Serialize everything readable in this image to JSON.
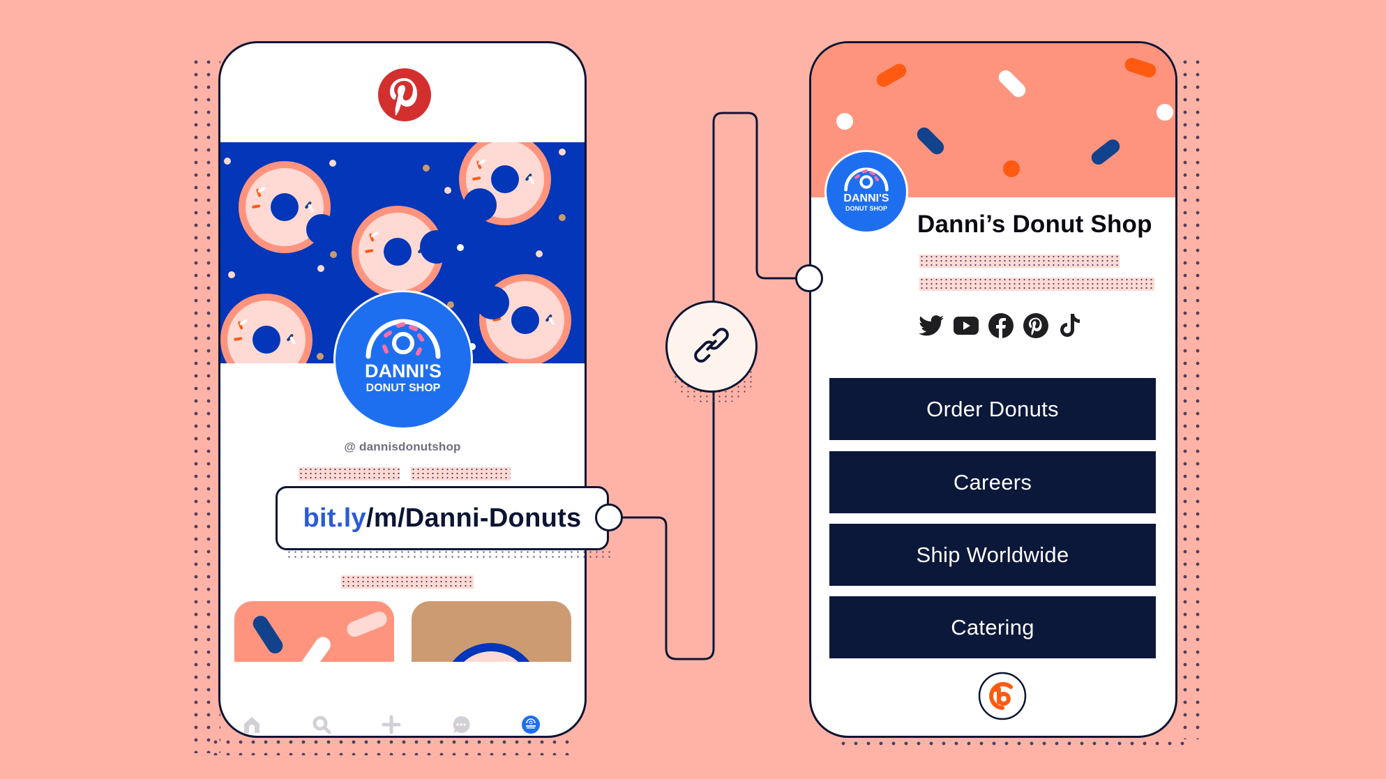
{
  "theme": {
    "background": "#ffb3a7",
    "outline": "#0c1433",
    "pinterest_red": "#d32f2f",
    "banner_blue": "#0336b8",
    "brand_blue": "#1e6ff0",
    "coral": "#ff947e",
    "button_navy": "#0c1839",
    "bitly_orange": "#ff5a12"
  },
  "left_phone": {
    "app": "Pinterest",
    "logo_icon": "pinterest-logo-icon",
    "avatar": {
      "line1": "DANNI'S",
      "line2": "DONUT SHOP"
    },
    "handle": "@ dannisdonutshop",
    "profile_link": {
      "domain": "bit.ly",
      "path": "/m/Danni-Donuts"
    },
    "nav": [
      {
        "icon": "home-icon"
      },
      {
        "icon": "search-icon"
      },
      {
        "icon": "plus-icon"
      },
      {
        "icon": "chat-icon"
      },
      {
        "icon": "profile-avatar-icon"
      }
    ]
  },
  "connector": {
    "icon": "link-chain-icon"
  },
  "right_phone": {
    "avatar": {
      "line1": "DANNI'S",
      "line2": "DONUT SHOP"
    },
    "shop_name": "Danni’s Donut Shop",
    "socials": [
      {
        "icon": "twitter-icon"
      },
      {
        "icon": "youtube-icon"
      },
      {
        "icon": "facebook-icon"
      },
      {
        "icon": "pinterest-icon"
      },
      {
        "icon": "tiktok-icon"
      }
    ],
    "links": [
      {
        "label": "Order Donuts"
      },
      {
        "label": "Careers"
      },
      {
        "label": "Ship Worldwide"
      },
      {
        "label": "Catering"
      }
    ],
    "footer_logo": "bitly-logo-icon"
  }
}
